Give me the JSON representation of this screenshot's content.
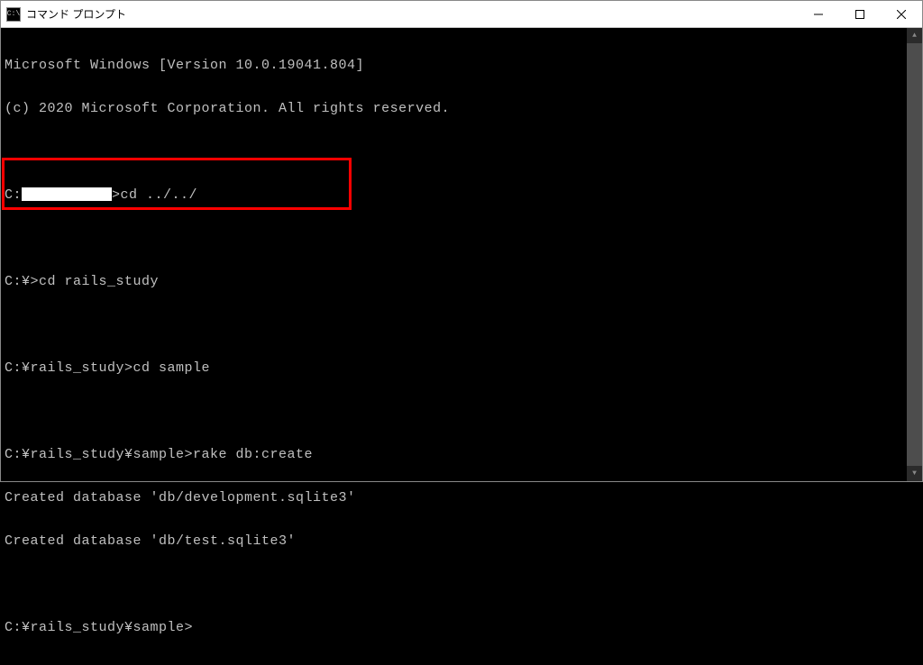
{
  "window": {
    "title": "コマンド プロンプト",
    "icon_text": "C:\\"
  },
  "terminal": {
    "line1": "Microsoft Windows [Version 10.0.19041.804]",
    "line2": "(c) 2020 Microsoft Corporation. All rights reserved.",
    "line3_prefix": "C:",
    "line3_suffix": ">cd ../../",
    "line4": "C:¥>cd rails_study",
    "line5": "C:¥rails_study>cd sample",
    "line6": "C:¥rails_study¥sample>rake db:create",
    "line7": "Created database 'db/development.sqlite3'",
    "line8": "Created database 'db/test.sqlite3'",
    "line9": "C:¥rails_study¥sample>"
  }
}
